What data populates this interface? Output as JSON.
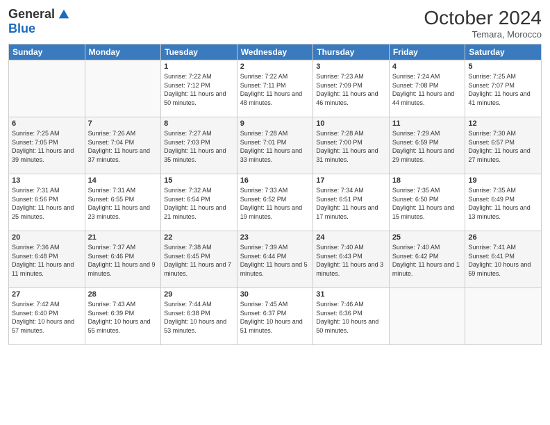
{
  "header": {
    "logo_general": "General",
    "logo_blue": "Blue",
    "month": "October 2024",
    "location": "Temara, Morocco"
  },
  "weekdays": [
    "Sunday",
    "Monday",
    "Tuesday",
    "Wednesday",
    "Thursday",
    "Friday",
    "Saturday"
  ],
  "weeks": [
    [
      {
        "day": "",
        "info": ""
      },
      {
        "day": "",
        "info": ""
      },
      {
        "day": "1",
        "info": "Sunrise: 7:22 AM\nSunset: 7:12 PM\nDaylight: 11 hours and 50 minutes."
      },
      {
        "day": "2",
        "info": "Sunrise: 7:22 AM\nSunset: 7:11 PM\nDaylight: 11 hours and 48 minutes."
      },
      {
        "day": "3",
        "info": "Sunrise: 7:23 AM\nSunset: 7:09 PM\nDaylight: 11 hours and 46 minutes."
      },
      {
        "day": "4",
        "info": "Sunrise: 7:24 AM\nSunset: 7:08 PM\nDaylight: 11 hours and 44 minutes."
      },
      {
        "day": "5",
        "info": "Sunrise: 7:25 AM\nSunset: 7:07 PM\nDaylight: 11 hours and 41 minutes."
      }
    ],
    [
      {
        "day": "6",
        "info": "Sunrise: 7:25 AM\nSunset: 7:05 PM\nDaylight: 11 hours and 39 minutes."
      },
      {
        "day": "7",
        "info": "Sunrise: 7:26 AM\nSunset: 7:04 PM\nDaylight: 11 hours and 37 minutes."
      },
      {
        "day": "8",
        "info": "Sunrise: 7:27 AM\nSunset: 7:03 PM\nDaylight: 11 hours and 35 minutes."
      },
      {
        "day": "9",
        "info": "Sunrise: 7:28 AM\nSunset: 7:01 PM\nDaylight: 11 hours and 33 minutes."
      },
      {
        "day": "10",
        "info": "Sunrise: 7:28 AM\nSunset: 7:00 PM\nDaylight: 11 hours and 31 minutes."
      },
      {
        "day": "11",
        "info": "Sunrise: 7:29 AM\nSunset: 6:59 PM\nDaylight: 11 hours and 29 minutes."
      },
      {
        "day": "12",
        "info": "Sunrise: 7:30 AM\nSunset: 6:57 PM\nDaylight: 11 hours and 27 minutes."
      }
    ],
    [
      {
        "day": "13",
        "info": "Sunrise: 7:31 AM\nSunset: 6:56 PM\nDaylight: 11 hours and 25 minutes."
      },
      {
        "day": "14",
        "info": "Sunrise: 7:31 AM\nSunset: 6:55 PM\nDaylight: 11 hours and 23 minutes."
      },
      {
        "day": "15",
        "info": "Sunrise: 7:32 AM\nSunset: 6:54 PM\nDaylight: 11 hours and 21 minutes."
      },
      {
        "day": "16",
        "info": "Sunrise: 7:33 AM\nSunset: 6:52 PM\nDaylight: 11 hours and 19 minutes."
      },
      {
        "day": "17",
        "info": "Sunrise: 7:34 AM\nSunset: 6:51 PM\nDaylight: 11 hours and 17 minutes."
      },
      {
        "day": "18",
        "info": "Sunrise: 7:35 AM\nSunset: 6:50 PM\nDaylight: 11 hours and 15 minutes."
      },
      {
        "day": "19",
        "info": "Sunrise: 7:35 AM\nSunset: 6:49 PM\nDaylight: 11 hours and 13 minutes."
      }
    ],
    [
      {
        "day": "20",
        "info": "Sunrise: 7:36 AM\nSunset: 6:48 PM\nDaylight: 11 hours and 11 minutes."
      },
      {
        "day": "21",
        "info": "Sunrise: 7:37 AM\nSunset: 6:46 PM\nDaylight: 11 hours and 9 minutes."
      },
      {
        "day": "22",
        "info": "Sunrise: 7:38 AM\nSunset: 6:45 PM\nDaylight: 11 hours and 7 minutes."
      },
      {
        "day": "23",
        "info": "Sunrise: 7:39 AM\nSunset: 6:44 PM\nDaylight: 11 hours and 5 minutes."
      },
      {
        "day": "24",
        "info": "Sunrise: 7:40 AM\nSunset: 6:43 PM\nDaylight: 11 hours and 3 minutes."
      },
      {
        "day": "25",
        "info": "Sunrise: 7:40 AM\nSunset: 6:42 PM\nDaylight: 11 hours and 1 minute."
      },
      {
        "day": "26",
        "info": "Sunrise: 7:41 AM\nSunset: 6:41 PM\nDaylight: 10 hours and 59 minutes."
      }
    ],
    [
      {
        "day": "27",
        "info": "Sunrise: 7:42 AM\nSunset: 6:40 PM\nDaylight: 10 hours and 57 minutes."
      },
      {
        "day": "28",
        "info": "Sunrise: 7:43 AM\nSunset: 6:39 PM\nDaylight: 10 hours and 55 minutes."
      },
      {
        "day": "29",
        "info": "Sunrise: 7:44 AM\nSunset: 6:38 PM\nDaylight: 10 hours and 53 minutes."
      },
      {
        "day": "30",
        "info": "Sunrise: 7:45 AM\nSunset: 6:37 PM\nDaylight: 10 hours and 51 minutes."
      },
      {
        "day": "31",
        "info": "Sunrise: 7:46 AM\nSunset: 6:36 PM\nDaylight: 10 hours and 50 minutes."
      },
      {
        "day": "",
        "info": ""
      },
      {
        "day": "",
        "info": ""
      }
    ]
  ]
}
